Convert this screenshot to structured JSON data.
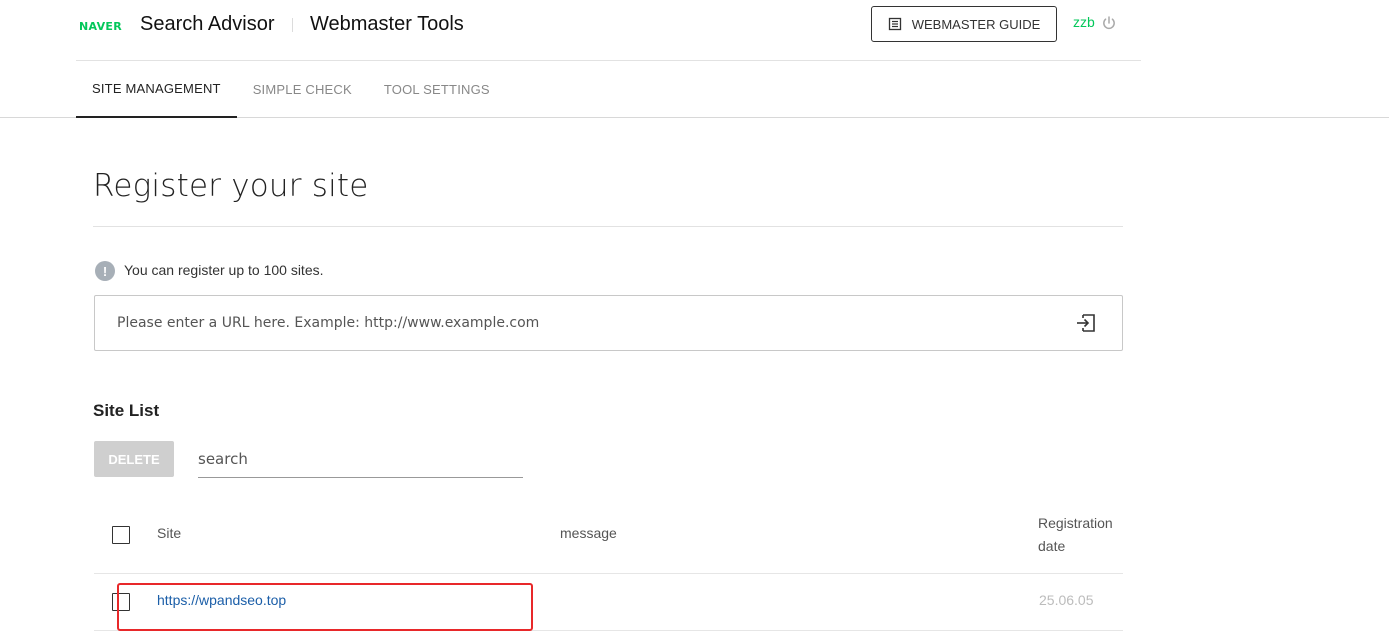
{
  "header": {
    "logo": "NAVER",
    "app_title": "Search Advisor",
    "app_subtitle": "Webmaster Tools",
    "guide_button": "WEBMASTER GUIDE",
    "username": "zzb"
  },
  "tabs": [
    {
      "label": "SITE MANAGEMENT",
      "active": true
    },
    {
      "label": "SIMPLE CHECK",
      "active": false
    },
    {
      "label": "TOOL SETTINGS",
      "active": false
    }
  ],
  "main": {
    "title": "Register your site",
    "info": "You can register up to 100 sites.",
    "url_placeholder": "Please enter a URL here. Example: http://www.example.com"
  },
  "site_list": {
    "title": "Site List",
    "delete_label": "DELETE",
    "search_placeholder": "search",
    "columns": {
      "site": "Site",
      "message": "message",
      "reg_line1": "Registration",
      "reg_line2": "date"
    },
    "rows": [
      {
        "site": "https://wpandseo.top",
        "message": "",
        "date": "25.06.05",
        "highlighted": true
      }
    ]
  },
  "colors": {
    "brand": "#03c75a",
    "link": "#1b5ea8",
    "highlight": "#e8282a",
    "disabled_button": "#cfcfcf"
  }
}
